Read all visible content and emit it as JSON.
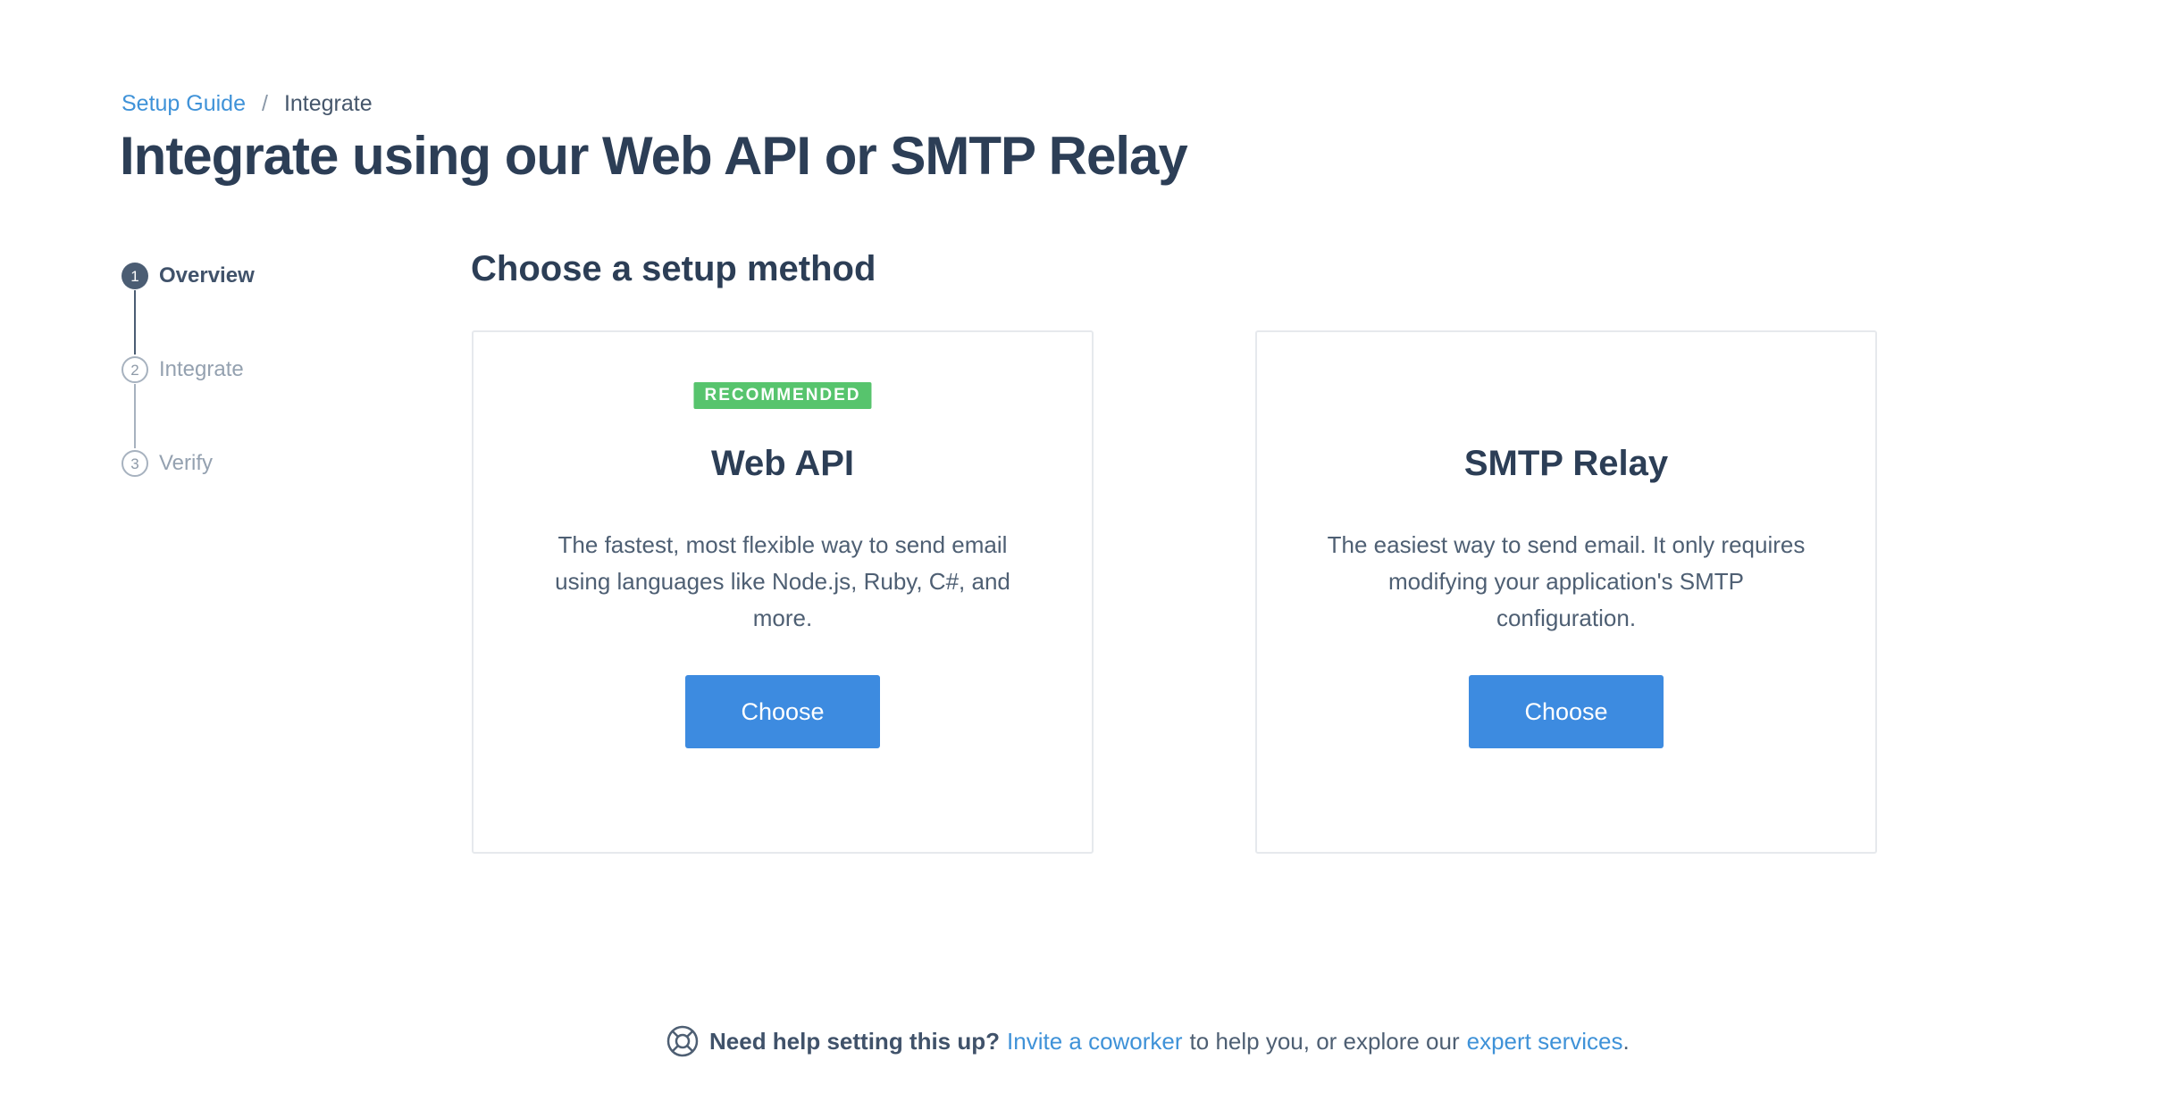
{
  "breadcrumb": {
    "parent": "Setup Guide",
    "separator": "/",
    "current": "Integrate"
  },
  "page_title": "Integrate using our Web API or SMTP Relay",
  "stepper": {
    "steps": [
      {
        "number": "1",
        "label": "Overview",
        "state": "active"
      },
      {
        "number": "2",
        "label": "Integrate",
        "state": "inactive"
      },
      {
        "number": "3",
        "label": "Verify",
        "state": "inactive"
      }
    ]
  },
  "section_title": "Choose a setup method",
  "cards": [
    {
      "badge": "RECOMMENDED",
      "title": "Web API",
      "description": "The fastest, most flexible way to send email using languages like Node.js, Ruby, C#, and more.",
      "button": "Choose"
    },
    {
      "title": "SMTP Relay",
      "description": "The easiest way to send email. It only requires modifying your application's SMTP configuration.",
      "button": "Choose"
    }
  ],
  "help": {
    "icon": "lifebuoy-icon",
    "bold": "Need help setting this up?",
    "link1": "Invite a coworker",
    "middle": "to help you, or explore our",
    "link2": "expert services",
    "end": "."
  },
  "colors": {
    "link": "#3f92d8",
    "badge": "#57c46d",
    "button": "#3d8be0",
    "heading": "#2c3e56",
    "step_active": "#4b5d73"
  }
}
